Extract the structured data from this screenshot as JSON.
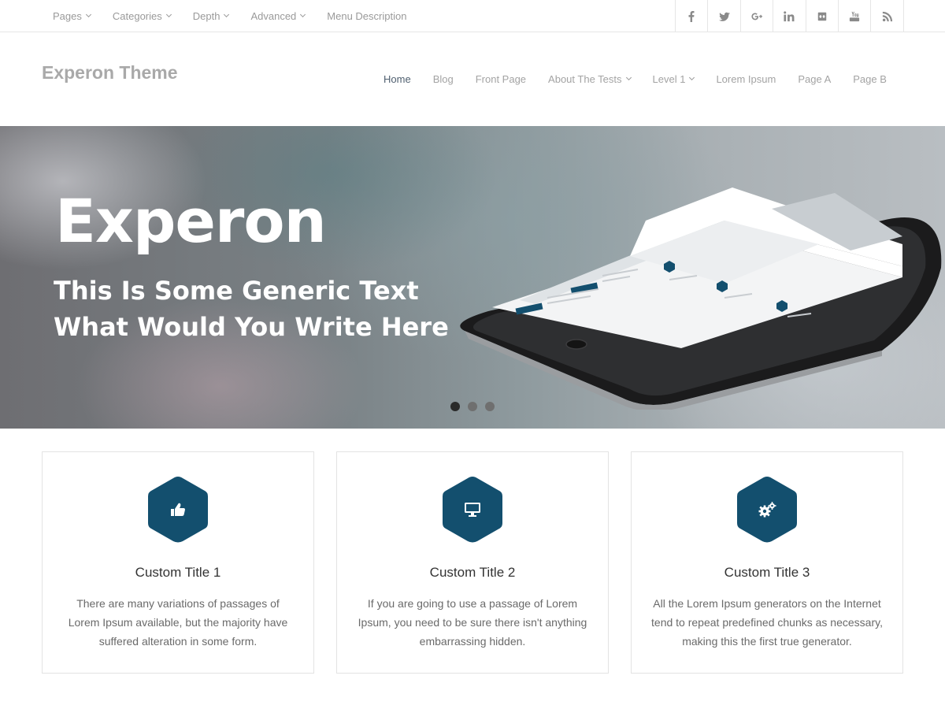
{
  "topbar": {
    "menu": [
      {
        "label": "Pages",
        "dropdown": true
      },
      {
        "label": "Categories",
        "dropdown": true
      },
      {
        "label": "Depth",
        "dropdown": true
      },
      {
        "label": "Advanced",
        "dropdown": true
      },
      {
        "label": "Menu Description",
        "dropdown": false
      }
    ],
    "social": [
      "facebook-icon",
      "twitter-icon",
      "google-plus-icon",
      "linkedin-icon",
      "flickr-icon",
      "youtube-icon",
      "rss-icon"
    ]
  },
  "header": {
    "logo": "Experon Theme",
    "nav": [
      {
        "label": "Home",
        "active": true,
        "dropdown": false
      },
      {
        "label": "Blog",
        "active": false,
        "dropdown": false
      },
      {
        "label": "Front Page",
        "active": false,
        "dropdown": false
      },
      {
        "label": "About The Tests",
        "active": false,
        "dropdown": true
      },
      {
        "label": "Level 1",
        "active": false,
        "dropdown": true
      },
      {
        "label": "Lorem Ipsum",
        "active": false,
        "dropdown": false
      },
      {
        "label": "Page A",
        "active": false,
        "dropdown": false
      },
      {
        "label": "Page B",
        "active": false,
        "dropdown": false
      }
    ]
  },
  "hero": {
    "title": "Experon",
    "subtitle_line1": "This Is Some Generic Text",
    "subtitle_line2": "What Would You Write Here",
    "slides": 3,
    "active_slide": 1
  },
  "features": [
    {
      "icon": "thumbs-up-icon",
      "title": "Custom Title 1",
      "text": "There are many variations of passages of Lorem Ipsum available, but the majority have suffered alteration in some form."
    },
    {
      "icon": "monitor-icon",
      "title": "Custom Title 2",
      "text": "If you are going to use a passage of Lorem Ipsum, you need to be sure there isn't anything embarrassing hidden."
    },
    {
      "icon": "gears-icon",
      "title": "Custom Title 3",
      "text": "All the Lorem Ipsum generators on the Internet tend to repeat predefined chunks as necessary, making this the first true generator."
    }
  ],
  "colors": {
    "accent": "#134f6e",
    "nav_active": "#506070",
    "muted_text": "#a3a3a3"
  }
}
